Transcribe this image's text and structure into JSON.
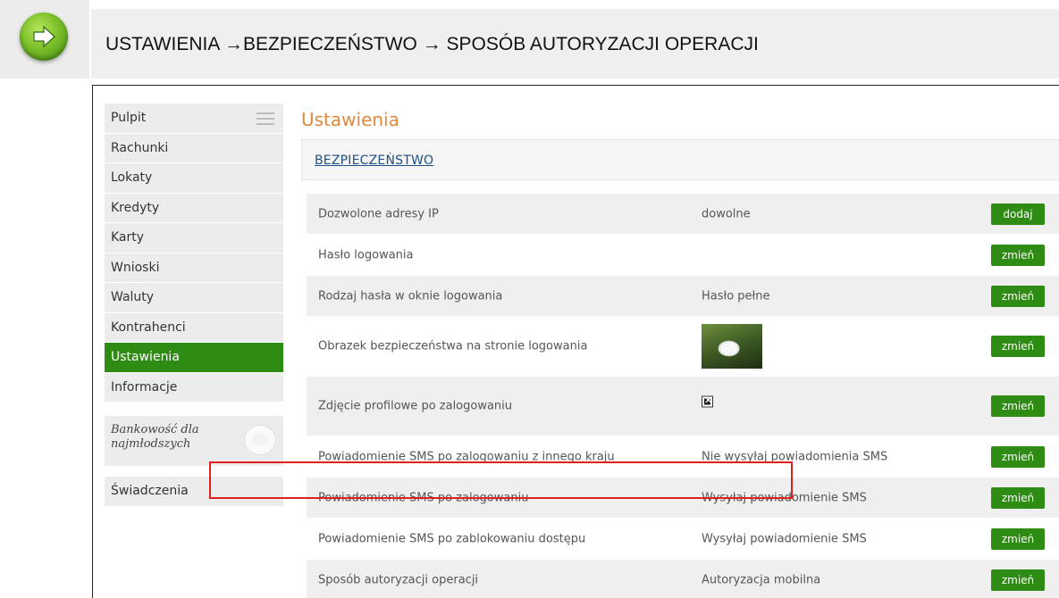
{
  "header": {
    "title": "USTAWIENIA →BEZPIECZEŃSTWO → SPOSÓB AUTORYZACJI OPERACJI",
    "icon": "arrow-right-icon"
  },
  "sidebar": {
    "items": [
      {
        "label": "Pulpit"
      },
      {
        "label": "Rachunki"
      },
      {
        "label": "Lokaty"
      },
      {
        "label": "Kredyty"
      },
      {
        "label": "Karty"
      },
      {
        "label": "Wnioski"
      },
      {
        "label": "Waluty"
      },
      {
        "label": "Kontrahenci"
      },
      {
        "label": "Ustawienia",
        "active": true
      },
      {
        "label": "Informacje"
      }
    ],
    "promo": {
      "line1": "Bankowość dla",
      "line2": "najmłodszych",
      "icon": "piggy-bank-icon"
    },
    "benefits_label": "Świadczenia"
  },
  "main": {
    "page_title": "Ustawienia",
    "section_title": "BEZPIECZEŃSTWO",
    "rows": [
      {
        "label": "Dozwolone adresy IP",
        "value": "dowolne",
        "button": "dodaj"
      },
      {
        "label": "Hasło logowania",
        "value": "",
        "button": "zmień"
      },
      {
        "label": "Rodzaj hasła w oknie logowania",
        "value": "Hasło pełne",
        "button": "zmień"
      },
      {
        "label": "Obrazek bezpieczeństwa na stronie logowania",
        "value": "",
        "button": "zmień"
      },
      {
        "label": "Zdjęcie profilowe po zalogowaniu",
        "value": "",
        "button": "zmień"
      },
      {
        "label": "Powiadomienie SMS po zalogowaniu z innego kraju",
        "value": "Nie wysyłaj powiadomienia SMS",
        "button": "zmień"
      },
      {
        "label": "Powiadomienie SMS po zalogowaniu",
        "value": "Wysyłaj powiadomienie SMS",
        "button": "zmień"
      },
      {
        "label": "Powiadomienie SMS po zablokowaniu dostępu",
        "value": "Wysyłaj powiadomienie SMS",
        "button": "zmień"
      },
      {
        "label": "Sposób autoryzacji operacji",
        "value": "Autoryzacja mobilna",
        "button": "zmień"
      }
    ]
  },
  "colors": {
    "accent_green": "#2e8b14",
    "title_orange": "#e0893d",
    "link_blue": "#1f4f87",
    "highlight_red": "#e02020"
  }
}
